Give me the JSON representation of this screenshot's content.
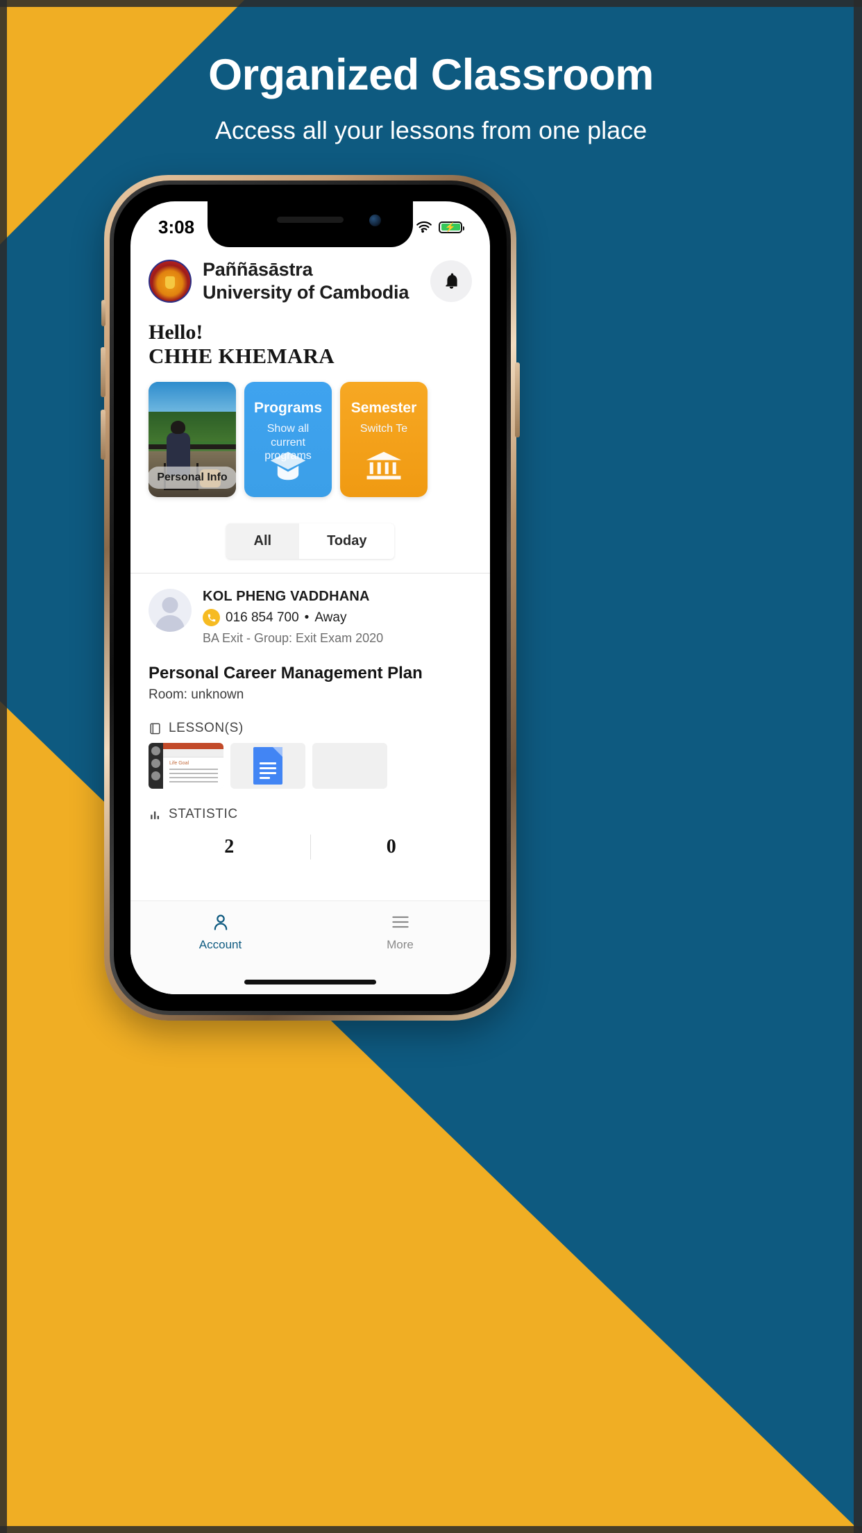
{
  "promo": {
    "title": "Organized Classroom",
    "subtitle": "Access all your lessons from one place",
    "bg_yellow": "#f0ae24",
    "bg_blue": "#0e5a80"
  },
  "status_bar": {
    "time": "3:08",
    "signal_icon": "cellular-signal-icon",
    "wifi_icon": "wifi-icon",
    "battery_icon": "battery-charging-icon"
  },
  "header": {
    "logo_icon": "university-crest-icon",
    "university_line1": "Paññāsāstra",
    "university_line2": "University of Cambodia",
    "notification_icon": "bell-icon"
  },
  "greeting": {
    "hello": "Hello!",
    "name": "CHHE KHEMARA"
  },
  "cards": [
    {
      "id": "personal-info",
      "type": "photo",
      "chip_label": "Personal Info"
    },
    {
      "id": "programs",
      "type": "tile",
      "title": "Programs",
      "subtitle": "Show all current programs",
      "icon": "graduation-cap-icon",
      "color": "#3fa3ef"
    },
    {
      "id": "semester",
      "type": "tile",
      "title": "Semester",
      "subtitle": "Switch Te",
      "icon": "bank-building-icon",
      "color": "#f7a823"
    }
  ],
  "filter_tabs": {
    "options": [
      "All",
      "Today"
    ],
    "selected": "Today"
  },
  "teacher": {
    "avatar_icon": "avatar-placeholder-icon",
    "name": "KOL PHENG VADDHANA",
    "phone_icon": "phone-icon",
    "phone": "016 854 700",
    "separator": "•",
    "status": "Away",
    "meta": "BA Exit   - Group: Exit Exam 2020"
  },
  "subject": {
    "title": "Personal Career Management Plan",
    "room": "Room: unknown"
  },
  "lessons_section": {
    "icon": "book-icon",
    "label": "LESSON(S)",
    "items": [
      {
        "id": "lesson-powerpoint",
        "kind": "powerpoint-thumbnail",
        "slide_title": "Life Goal"
      },
      {
        "id": "lesson-gdoc",
        "kind": "google-doc-icon"
      },
      {
        "id": "lesson-empty",
        "kind": "empty-placeholder"
      }
    ]
  },
  "statistic_section": {
    "icon": "bar-chart-icon",
    "label": "STATISTIC",
    "values": [
      "2",
      "0"
    ]
  },
  "bottom_nav": {
    "items": [
      {
        "id": "account",
        "label": "Account",
        "icon": "person-icon",
        "active": true
      },
      {
        "id": "more",
        "label": "More",
        "icon": "hamburger-icon",
        "active": false
      }
    ]
  }
}
